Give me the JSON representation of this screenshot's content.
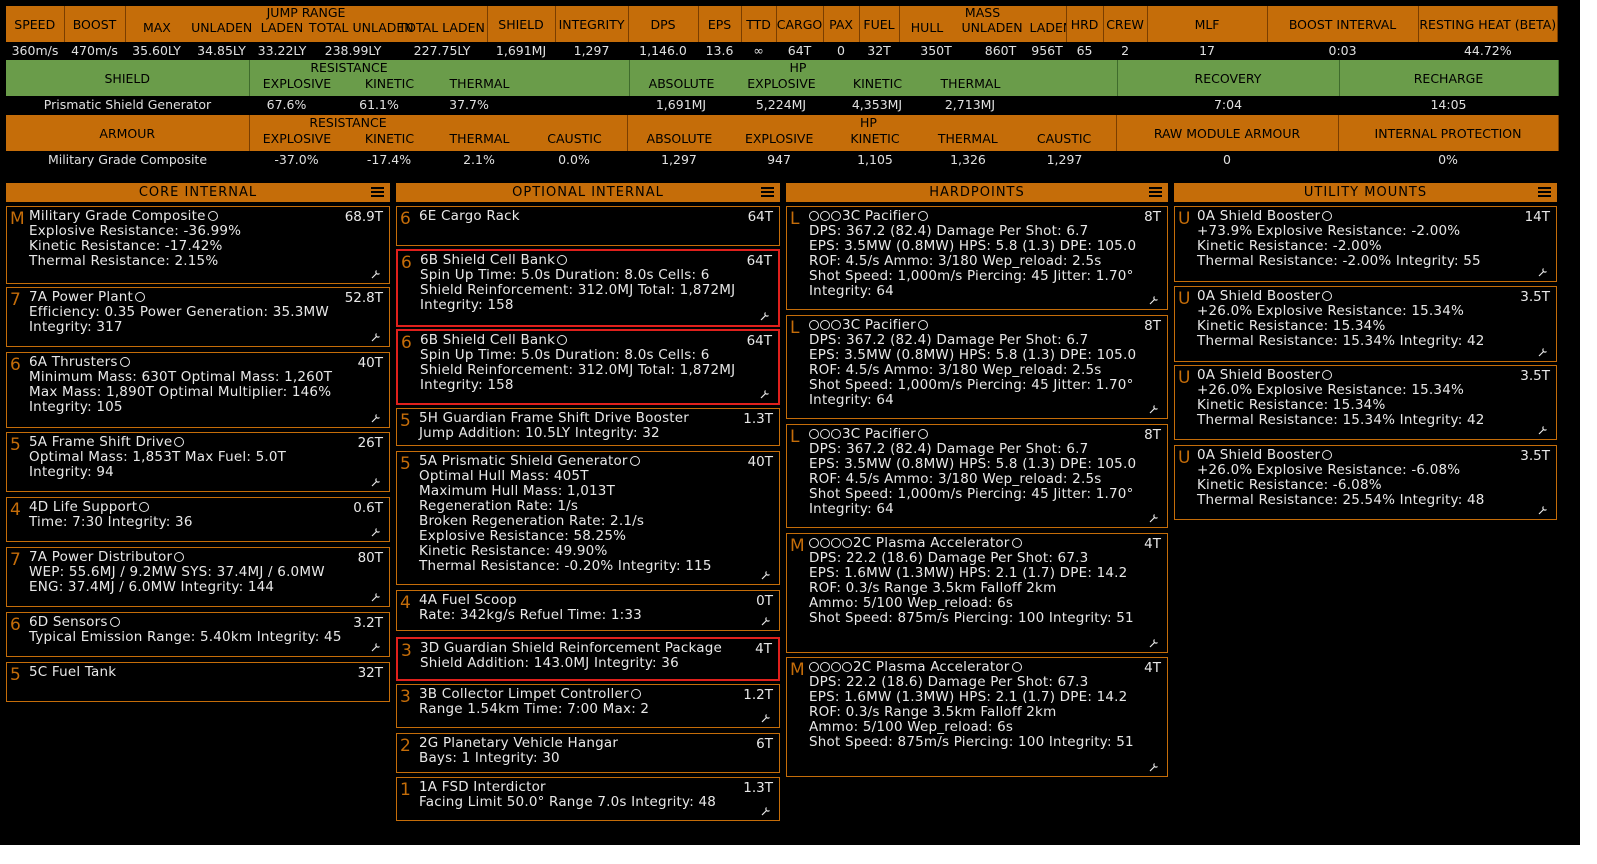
{
  "stats": {
    "headers": [
      "SPEED",
      "BOOST",
      "JUMP RANGE",
      "SHIELD",
      "INTEGRITY",
      "DPS",
      "EPS",
      "TTD",
      "CARGO",
      "PAX",
      "FUEL",
      "MASS",
      "HRD",
      "CREW",
      "MLF",
      "BOOST INTERVAL",
      "RESTING HEAT (BETA)"
    ],
    "jump_sub": [
      "MAX",
      "UNLADEN",
      "LADEN",
      "TOTAL UNLADEN",
      "TOTAL LADEN"
    ],
    "mass_sub": [
      "HULL",
      "UNLADEN",
      "LADEN"
    ],
    "values": [
      "360m/s",
      "470m/s",
      "35.60LY",
      "34.85LY",
      "33.22LY",
      "238.99LY",
      "227.75LY",
      "1,691MJ",
      "1,297",
      "1,146.0",
      "13.6",
      "∞",
      "64T",
      "0",
      "32T",
      "350T",
      "860T",
      "956T",
      "65",
      "2",
      "17",
      "0:03",
      "44.72%"
    ]
  },
  "shield_table": {
    "label_shield": "SHIELD",
    "label_resistance": "RESISTANCE",
    "label_hp": "HP",
    "label_recovery": "RECOVERY",
    "label_recharge": "RECHARGE",
    "res_sub": [
      "EXPLOSIVE",
      "KINETIC",
      "THERMAL"
    ],
    "hp_sub": [
      "ABSOLUTE",
      "EXPLOSIVE",
      "KINETIC",
      "THERMAL"
    ],
    "name": "Prismatic Shield Generator",
    "values": [
      "67.6%",
      "61.1%",
      "37.7%",
      "1,691MJ",
      "5,224MJ",
      "4,353MJ",
      "2,713MJ",
      "7:04",
      "14:05"
    ]
  },
  "armour_table": {
    "label_armour": "ARMOUR",
    "label_resistance": "RESISTANCE",
    "label_hp": "HP",
    "label_raw": "RAW MODULE ARMOUR",
    "label_internal": "INTERNAL PROTECTION",
    "res_sub": [
      "EXPLOSIVE",
      "KINETIC",
      "THERMAL",
      "CAUSTIC"
    ],
    "hp_sub": [
      "ABSOLUTE",
      "EXPLOSIVE",
      "KINETIC",
      "THERMAL",
      "CAUSTIC"
    ],
    "name": "Military Grade Composite",
    "values": [
      "-37.0%",
      "-17.4%",
      "2.1%",
      "0.0%",
      "1,297",
      "947",
      "1,105",
      "1,326",
      "1,297",
      "0",
      "0%"
    ]
  },
  "colors": {
    "accent": "#c56d09",
    "shield_green": "#6a9c4a",
    "highlight": "#e0201c"
  },
  "columns": [
    {
      "title": "CORE INTERNAL",
      "cards": [
        {
          "cls": "M",
          "name": "Military Grade Composite",
          "mass": "68.9T",
          "lines": [
            "Explosive Resistance: -36.99%",
            "Kinetic Resistance: -17.42%",
            "Thermal Resistance: 2.15%"
          ]
        },
        {
          "cls": "7",
          "name": "7A Power Plant",
          "mass": "52.8T",
          "lines": [
            "Efficiency: 0.35  Power Generation: 35.3MW",
            "Integrity: 317"
          ]
        },
        {
          "cls": "6",
          "name": "6A Thrusters",
          "mass": "40T",
          "lines": [
            "Minimum Mass: 630T  Optimal Mass: 1,260T",
            "Max Mass: 1,890T  Optimal Multiplier: 146%",
            "Integrity: 105"
          ]
        },
        {
          "cls": "5",
          "name": "5A Frame Shift Drive",
          "mass": "26T",
          "lines": [
            "Optimal Mass: 1,853T  Max Fuel: 5.0T",
            "Integrity: 94"
          ]
        },
        {
          "cls": "4",
          "name": "4D Life Support",
          "mass": "0.6T",
          "lines": [
            "Time: 7:30  Integrity: 36"
          ]
        },
        {
          "cls": "7",
          "name": "7A Power Distributor",
          "mass": "80T",
          "lines": [
            "WEP: 55.6MJ / 9.2MW  SYS: 37.4MJ / 6.0MW",
            "ENG: 37.4MJ / 6.0MW  Integrity: 144"
          ]
        },
        {
          "cls": "6",
          "name": "6D Sensors",
          "mass": "3.2T",
          "lines": [
            "Typical Emission Range: 5.40km  Integrity: 45"
          ]
        },
        {
          "cls": "5",
          "name": "5C Fuel Tank",
          "mass": "32T",
          "lines": []
        }
      ]
    },
    {
      "title": "OPTIONAL INTERNAL",
      "cards": [
        {
          "cls": "6",
          "name": "6E Cargo Rack",
          "mass": "64T",
          "lines": []
        },
        {
          "cls": "6",
          "name": "6B Shield Cell Bank",
          "mass": "64T",
          "lines": [
            "Spin Up Time: 5.0s  Duration: 8.0s  Cells: 6",
            "Shield Reinforcement: 312.0MJ  Total: 1,872MJ",
            "Integrity: 158"
          ]
        },
        {
          "cls": "6",
          "name": "6B Shield Cell Bank",
          "mass": "64T",
          "lines": [
            "Spin Up Time: 5.0s  Duration: 8.0s  Cells: 6",
            "Shield Reinforcement: 312.0MJ  Total: 1,872MJ",
            "Integrity: 158"
          ]
        },
        {
          "cls": "5",
          "name": "5H Guardian Frame Shift Drive Booster",
          "mass": "1.3T",
          "lines": [
            "Jump Addition: 10.5LY  Integrity: 32"
          ]
        },
        {
          "cls": "5",
          "name": "5A Prismatic Shield Generator",
          "mass": "40T",
          "lines": [
            "Optimal Hull Mass: 405T",
            "Maximum Hull Mass: 1,013T",
            "Regeneration Rate: 1/s",
            "Broken Regeneration Rate: 2.1/s",
            "Explosive Resistance: 58.25%",
            "Kinetic Resistance: 49.90%",
            "Thermal Resistance: -0.20%  Integrity: 115"
          ]
        },
        {
          "cls": "4",
          "name": "4A Fuel Scoop",
          "mass": "0T",
          "lines": [
            "Rate: 342kg/s  Refuel Time: 1:33"
          ]
        },
        {
          "cls": "3",
          "name": "3D Guardian Shield Reinforcement Package",
          "mass": "4T",
          "lines": [
            "Shield Addition: 143.0MJ  Integrity: 36"
          ]
        },
        {
          "cls": "3",
          "name": "3B Collector Limpet Controller",
          "mass": "1.2T",
          "lines": [
            "Range 1.54km  Time: 7:00  Max: 2"
          ]
        },
        {
          "cls": "2",
          "name": "2G Planetary Vehicle Hangar",
          "mass": "6T",
          "lines": [
            "Bays: 1  Integrity: 30"
          ]
        },
        {
          "cls": "1",
          "name": "1A FSD Interdictor",
          "mass": "1.3T",
          "lines": [
            "Facing Limit 50.0°  Range 7.0s  Integrity: 48"
          ]
        }
      ]
    },
    {
      "title": "HARDPOINTS",
      "cards": [
        {
          "cls": "L",
          "name": "3C Pacifier",
          "mass": "8T",
          "lines": [
            "DPS: 367.2 (82.4)  Damage Per Shot: 6.7",
            "EPS: 3.5MW (0.8MW)  HPS: 5.8 (1.3)  DPE: 105.0",
            "ROF: 4.5/s  Ammo: 3/180  Wep_reload: 2.5s",
            "Shot Speed: 1,000m/s  Piercing: 45  Jitter: 1.70°",
            "Integrity: 64"
          ]
        },
        {
          "cls": "L",
          "name": "3C Pacifier",
          "mass": "8T",
          "lines": [
            "DPS: 367.2 (82.4)  Damage Per Shot: 6.7",
            "EPS: 3.5MW (0.8MW)  HPS: 5.8 (1.3)  DPE: 105.0",
            "ROF: 4.5/s  Ammo: 3/180  Wep_reload: 2.5s",
            "Shot Speed: 1,000m/s  Piercing: 45  Jitter: 1.70°",
            "Integrity: 64"
          ]
        },
        {
          "cls": "L",
          "name": "3C Pacifier",
          "mass": "8T",
          "lines": [
            "DPS: 367.2 (82.4)  Damage Per Shot: 6.7",
            "EPS: 3.5MW (0.8MW)  HPS: 5.8 (1.3)  DPE: 105.0",
            "ROF: 4.5/s  Ammo: 3/180  Wep_reload: 2.5s",
            "Shot Speed: 1,000m/s  Piercing: 45  Jitter: 1.70°",
            "Integrity: 64"
          ]
        },
        {
          "cls": "M",
          "name": "2C Plasma Accelerator",
          "mass": "4T",
          "lines": [
            "DPS: 22.2 (18.6)  Damage Per Shot: 67.3",
            "EPS: 1.6MW (1.3MW)  HPS: 2.1 (1.7)  DPE: 14.2",
            "ROF: 0.3/s  Range 3.5km  Falloff 2km",
            "Ammo: 5/100  Wep_reload: 6s",
            "Shot Speed: 875m/s  Piercing: 100  Integrity: 51"
          ]
        },
        {
          "cls": "M",
          "name": "2C Plasma Accelerator",
          "mass": "4T",
          "lines": [
            "DPS: 22.2 (18.6)  Damage Per Shot: 67.3",
            "EPS: 1.6MW (1.3MW)  HPS: 2.1 (1.7)  DPE: 14.2",
            "ROF: 0.3/s  Range 3.5km  Falloff 2km",
            "Ammo: 5/100  Wep_reload: 6s",
            "Shot Speed: 875m/s  Piercing: 100  Integrity: 51"
          ]
        }
      ]
    },
    {
      "title": "UTILITY MOUNTS",
      "cards": [
        {
          "cls": "U",
          "name": "0A Shield Booster",
          "mass": "14T",
          "lines": [
            "+73.9%  Explosive Resistance: -2.00%",
            "Kinetic Resistance: -2.00%",
            "Thermal Resistance: -2.00%  Integrity: 55"
          ]
        },
        {
          "cls": "U",
          "name": "0A Shield Booster",
          "mass": "3.5T",
          "lines": [
            "+26.0%  Explosive Resistance: 15.34%",
            "Kinetic Resistance: 15.34%",
            "Thermal Resistance: 15.34%  Integrity: 42"
          ]
        },
        {
          "cls": "U",
          "name": "0A Shield Booster",
          "mass": "3.5T",
          "lines": [
            "+26.0%  Explosive Resistance: 15.34%",
            "Kinetic Resistance: 15.34%",
            "Thermal Resistance: 15.34%  Integrity: 42"
          ]
        },
        {
          "cls": "U",
          "name": "0A Shield Booster",
          "mass": "3.5T",
          "lines": [
            "+26.0%  Explosive Resistance: -6.08%",
            "Kinetic Resistance: -6.08%",
            "Thermal Resistance: 25.54%  Integrity: 48"
          ]
        }
      ]
    }
  ]
}
